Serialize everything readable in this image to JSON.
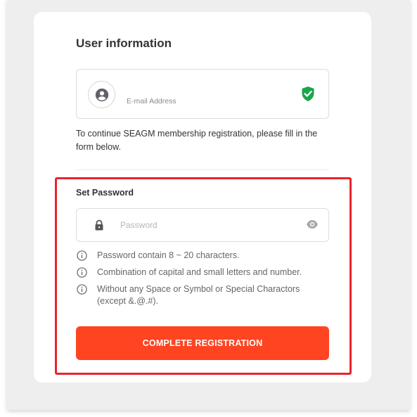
{
  "user_info": {
    "title": "User information",
    "email_label": "E-mail Address",
    "verified_icon": "verified-shield-icon",
    "verified_color": "#1aa64a",
    "info_text": "To continue SEAGM membership registration, please fill in the form below."
  },
  "password": {
    "title": "Set Password",
    "placeholder": "Password",
    "value": "",
    "rules": [
      {
        "text": "Password contain 8 ~ 20 characters."
      },
      {
        "text": "Combination of capital and small letters and number."
      },
      {
        "text": "Without any Space or Symbol or Special Charactors (except &.@.#)."
      }
    ]
  },
  "submit": {
    "label": "COMPLETE REGISTRATION",
    "color": "#ff4422"
  },
  "highlight": {
    "color": "#e8242c"
  }
}
